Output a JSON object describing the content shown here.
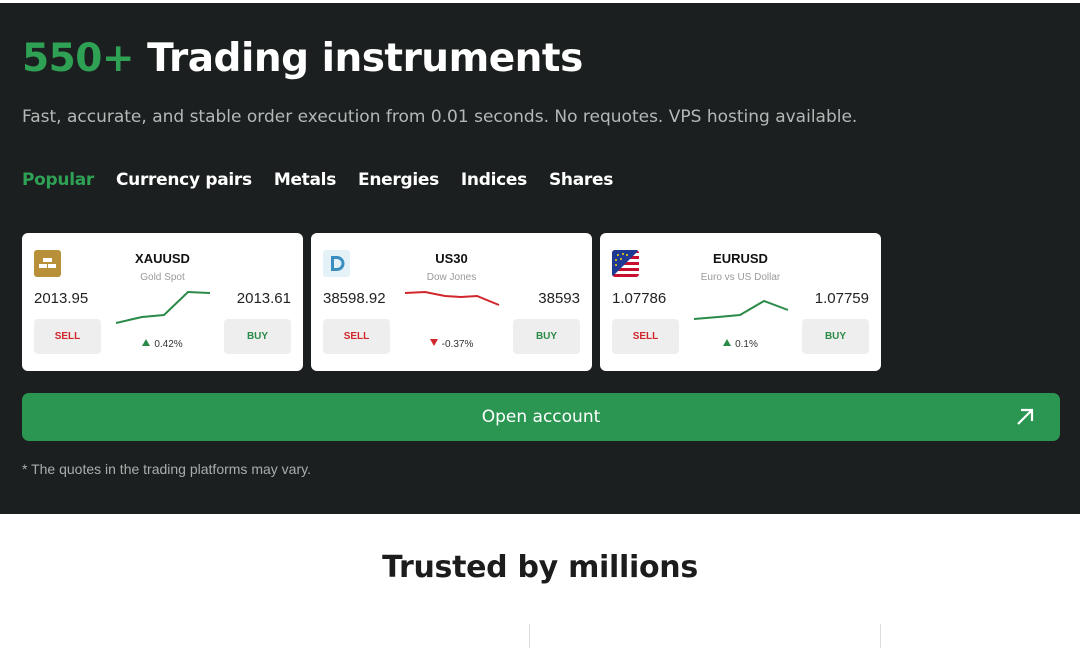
{
  "header": {
    "title_accent": "550+",
    "title_rest": "Trading instruments",
    "subtitle": "Fast, accurate, and stable order execution from 0.01 seconds. No requotes. VPS hosting available."
  },
  "tabs": [
    {
      "label": "Popular",
      "active": true
    },
    {
      "label": "Currency pairs",
      "active": false
    },
    {
      "label": "Metals",
      "active": false
    },
    {
      "label": "Energies",
      "active": false
    },
    {
      "label": "Indices",
      "active": false
    },
    {
      "label": "Shares",
      "active": false
    }
  ],
  "instruments": [
    {
      "symbol": "XAUUSD",
      "description": "Gold Spot",
      "bid": "2013.95",
      "ask": "2013.61",
      "change": "0.42%",
      "direction": "up",
      "sell_label": "SELL",
      "buy_label": "BUY",
      "icon": "gold-bar-icon",
      "line_color": "#2a8a47"
    },
    {
      "symbol": "US30",
      "description": "Dow Jones",
      "bid": "38598.92",
      "ask": "38593",
      "change": "-0.37%",
      "direction": "down",
      "sell_label": "SELL",
      "buy_label": "BUY",
      "icon": "dow-jones-logo-icon",
      "line_color": "#d0262c"
    },
    {
      "symbol": "EURUSD",
      "description": "Euro vs US Dollar",
      "bid": "1.07786",
      "ask": "1.07759",
      "change": "0.1%",
      "direction": "up",
      "sell_label": "SELL",
      "buy_label": "BUY",
      "icon": "eu-us-flag-icon",
      "line_color": "#2a8a47"
    }
  ],
  "cta": {
    "label": "Open account",
    "icon": "arrow-up-right-icon"
  },
  "note": "* The quotes in the trading platforms may vary.",
  "trusted": {
    "title": "Trusted by millions"
  },
  "colors": {
    "accent": "#2ea155",
    "button": "#2a9652",
    "background_dark": "#1c1f1f",
    "sell": "#d0262c",
    "buy": "#2a8a47"
  }
}
